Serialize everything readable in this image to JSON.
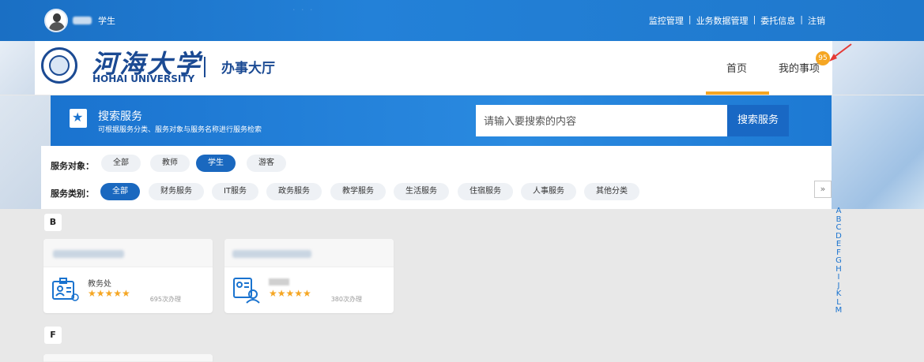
{
  "topbar": {
    "role": "学生",
    "links": [
      "监控管理",
      "业务数据管理",
      "委托信息",
      "注销"
    ],
    "separator": "|"
  },
  "header": {
    "logo_text": "河海大学",
    "logo_en": "HOHAI UNIVERSITY",
    "hall": "办事大厅",
    "nav_home": "首页",
    "nav_mine": "我的事项",
    "badge": "95"
  },
  "search": {
    "title": "搜索服务",
    "subtitle": "可根据服务分类、服务对象与服务名称进行服务检索",
    "placeholder": "请输入要搜索的内容",
    "button": "搜索服务"
  },
  "filters": {
    "target_label": "服务对象：",
    "targets": [
      "全部",
      "教师",
      "学生",
      "游客"
    ],
    "target_active": "学生",
    "category_label": "服务类别：",
    "categories": [
      "全部",
      "财务服务",
      "IT服务",
      "政务服务",
      "教学服务",
      "生活服务",
      "住宿服务",
      "人事服务",
      "其他分类"
    ],
    "category_active": "全部",
    "expand_icon": "double-chevron-down-icon"
  },
  "groups": [
    {
      "letter": "B",
      "cards": [
        {
          "dept": "教务处",
          "stars": "★★★★★",
          "count": "695次办理"
        },
        {
          "dept": "",
          "stars": "★★★★★",
          "count": "380次办理"
        }
      ]
    },
    {
      "letter": "F",
      "cards": []
    }
  ],
  "az_index": [
    "A",
    "B",
    "C",
    "D",
    "E",
    "F",
    "G",
    "H",
    "I",
    "J",
    "K",
    "L",
    "M"
  ],
  "colors": {
    "primary": "#1a73cf",
    "accent": "#f5a623",
    "dark_blue": "#1b4a93"
  }
}
